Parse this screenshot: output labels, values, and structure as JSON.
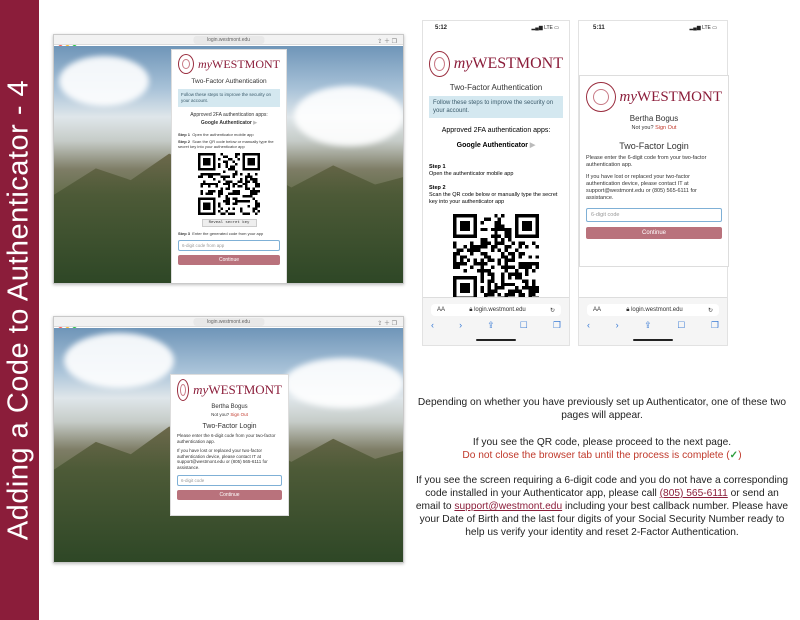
{
  "banner": {
    "title": "Adding a Code to Authenticator - 4"
  },
  "browser_top": {
    "url": "login.westmont.edu",
    "card": {
      "brand_my": "my",
      "brand_name": "WESTMONT",
      "title": "Two-Factor Authentication",
      "info": "Follow these steps to improve the security on your account.",
      "approved_label": "Approved 2FA authentication apps:",
      "app_name": "Google Authenticator",
      "step1_label": "Step 1",
      "step1_text": "Open the authenticator mobile app",
      "step2_label": "Step 2",
      "step2_text": "Scan the QR code below or manually type the secret key into your authenticator app",
      "reveal_button": "Reveal secret key",
      "step3_label": "Step 3",
      "step3_text": "Enter the generated code from your app",
      "code_placeholder": "6-digit code from app",
      "continue_button": "Continue"
    }
  },
  "browser_bottom": {
    "url": "login.westmont.edu",
    "card": {
      "brand_my": "my",
      "brand_name": "WESTMONT",
      "user_name": "Bertha Bogus",
      "not_you": "Not you?",
      "sign_out": "Sign Out",
      "title": "Two-Factor Login",
      "instruction": "Please enter the 6-digit code from your two-factor authentication app.",
      "lost_device": "If you have lost or replaced your two-factor authentication device, please contact IT at support@westmont.edu or (805) 565-6111 for assistance.",
      "code_placeholder": "6-digit code",
      "continue_button": "Continue"
    }
  },
  "phone_left": {
    "time": "5:12",
    "signal": "LTE",
    "card": {
      "brand_my": "my",
      "brand_name": "WESTMONT",
      "title": "Two-Factor Authentication",
      "info": "Follow these steps to improve the security on your account.",
      "approved_label": "Approved 2FA authentication apps:",
      "app_name": "Google Authenticator",
      "step1_label": "Step 1",
      "step1_text": "Open the authenticator mobile app",
      "step2_label": "Step 2",
      "step2_text": "Scan the QR code below or manually type the secret key into your authenticator app"
    },
    "address_aa": "AA",
    "address": "login.westmont.edu"
  },
  "phone_right": {
    "time": "5:11",
    "signal": "LTE",
    "card": {
      "brand_my": "my",
      "brand_name": "WESTMONT",
      "user_name": "Bertha Bogus",
      "not_you": "Not you?",
      "sign_out": "Sign Out",
      "title": "Two-Factor Login",
      "instruction": "Please enter the 6-digit code from your two-factor authentication app.",
      "lost_device": "If you have lost or replaced your two-factor authentication device, please contact IT at support@westmont.edu or (805) 565-6111 for assistance.",
      "code_placeholder": "6-digit code",
      "continue_button": "Continue"
    },
    "address_aa": "AA",
    "address": "login.westmont.edu"
  },
  "instructions": {
    "p1": "Depending on whether you have previously set up Authenticator, one of these two pages will appear.",
    "p2": "If you see the QR code, please proceed to the next page.",
    "p2_warning": "Do not close the browser tab until the process is complete (",
    "p2_check": "✓",
    "p2_end": ")",
    "p3_a": "If you see the screen requiring a 6-digit code and you do not have a corresponding code installed in your Authenticator app, please call ",
    "p3_phone": "(805) 565-6111",
    "p3_b": " or send an email to ",
    "p3_email": "support@westmont.edu",
    "p3_c": " including your best callback number. Please have your Date of Birth and the last four digits of your Social Security Number ready to help us verify your identity and reset 2-Factor Authentication."
  },
  "colors": {
    "banner": "#8b1d3a",
    "brand": "#8b1d3a",
    "button": "#b9727c",
    "info_box": "#d4e8f0",
    "warning": "#c0392b",
    "check": "#2e9e3e"
  }
}
